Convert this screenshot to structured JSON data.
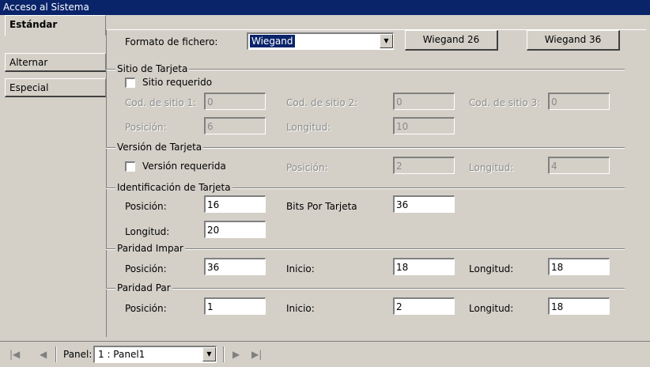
{
  "window": {
    "title": "Acceso al Sistema"
  },
  "tabs": [
    {
      "label": "Estándar",
      "active": true
    },
    {
      "label": "Alternar",
      "active": false
    },
    {
      "label": "Especial",
      "active": false
    }
  ],
  "format": {
    "label": "Formato de fichero:",
    "selected": "Wiegand",
    "btn26": "Wiegand 26",
    "btn36": "Wiegand 36"
  },
  "site": {
    "title": "Sitio de Tarjeta",
    "required_label": "Sitio requerido",
    "code1_label": "Cod. de sitio 1:",
    "code1_value": "0",
    "code2_label": "Cod. de sitio 2:",
    "code2_value": "0",
    "code3_label": "Cod. de sitio 3:",
    "code3_value": "0",
    "pos_label": "Posición:",
    "pos_value": "6",
    "len_label": "Longitud:",
    "len_value": "10"
  },
  "version": {
    "title": "Versión de Tarjeta",
    "required_label": "Versión requerida",
    "pos_label": "Posición:",
    "pos_value": "2",
    "len_label": "Longitud:",
    "len_value": "4"
  },
  "ident": {
    "title": "Identificación de Tarjeta",
    "pos_label": "Posición:",
    "pos_value": "16",
    "bits_label": "Bits Por Tarjeta",
    "bits_value": "36",
    "len_label": "Longitud:",
    "len_value": "20"
  },
  "odd": {
    "title": "Paridad Impar",
    "pos_label": "Posición:",
    "pos_value": "36",
    "start_label": "Inicio:",
    "start_value": "18",
    "len_label": "Longitud:",
    "len_value": "18"
  },
  "even": {
    "title": "Paridad Par",
    "pos_label": "Posición:",
    "pos_value": "1",
    "start_label": "Inicio:",
    "start_value": "2",
    "len_label": "Longitud:",
    "len_value": "18"
  },
  "nav": {
    "panel_label": "Panel:",
    "panel_selected": "1 : Panel1"
  }
}
